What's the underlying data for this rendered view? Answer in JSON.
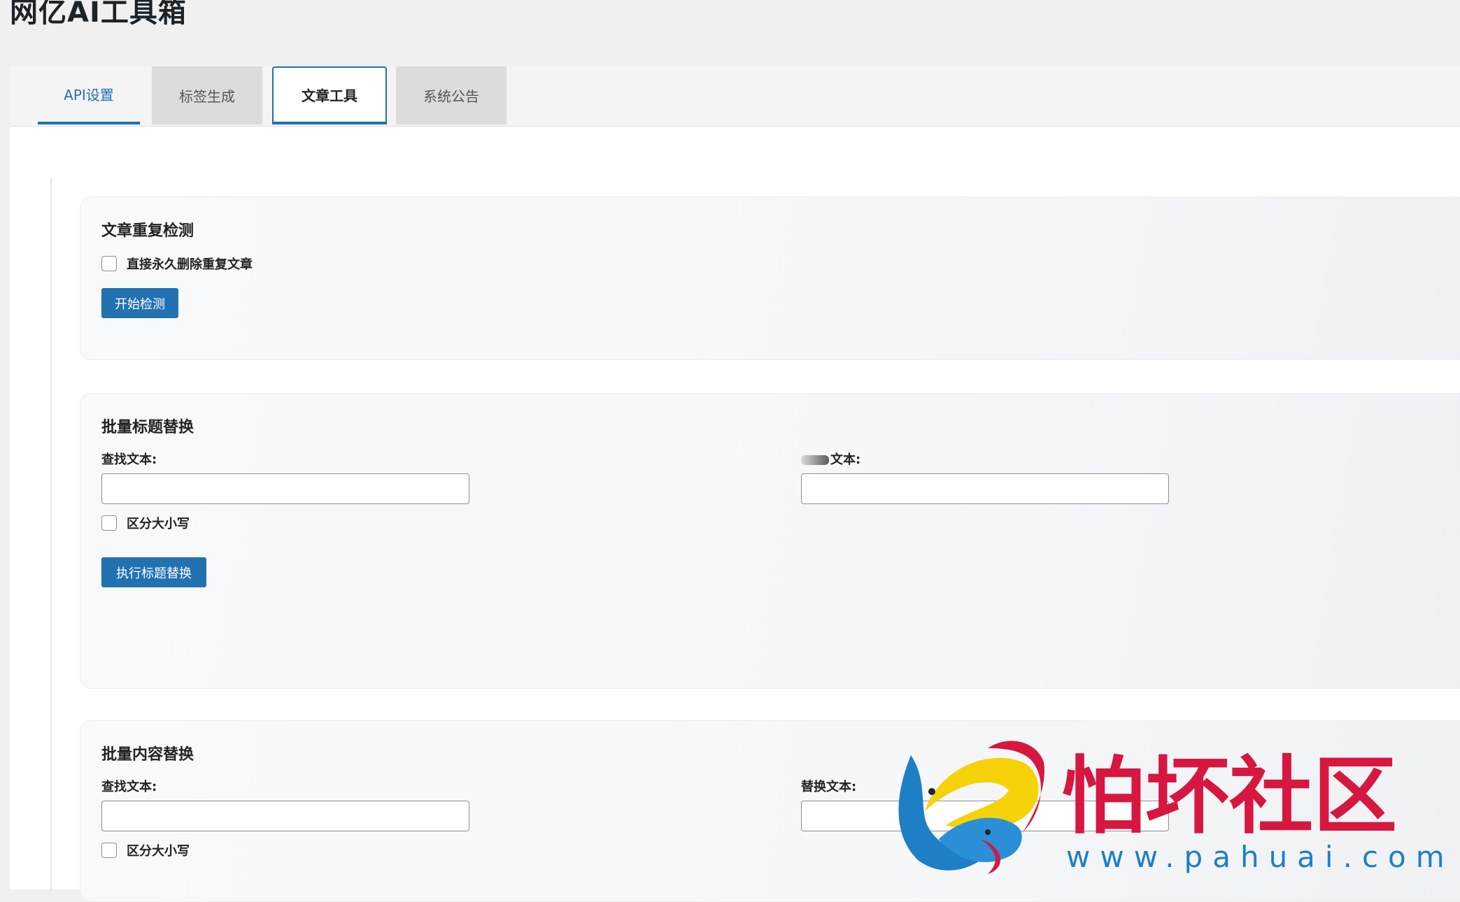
{
  "app": {
    "title": "网亿AI工具箱"
  },
  "tabs": [
    {
      "label": "API设置"
    },
    {
      "label": "标签生成"
    },
    {
      "label": "文章工具"
    },
    {
      "label": "系统公告"
    }
  ],
  "active_tab": "文章工具",
  "duplicate_check": {
    "title": "文章重复检测",
    "checkbox_label": "直接永久删除重复文章",
    "button_label": "开始检测"
  },
  "title_replace": {
    "title": "批量标题替换",
    "find_label": "查找文本:",
    "replace_label": "文本:",
    "case_label": "区分大小写",
    "button_label": "执行标题替换"
  },
  "content_replace": {
    "title": "批量内容替换",
    "find_label": "查找文本:",
    "replace_label": "替换文本:",
    "case_label": "区分大小写"
  },
  "watermark": {
    "brand_text": "怕坏社区",
    "url_text": "www.pahuai.com",
    "brand_color": "#d6173f",
    "url_color": "#1e7fc6"
  },
  "colors": {
    "accent": "#2271b1",
    "background": "#f0f0f1"
  }
}
